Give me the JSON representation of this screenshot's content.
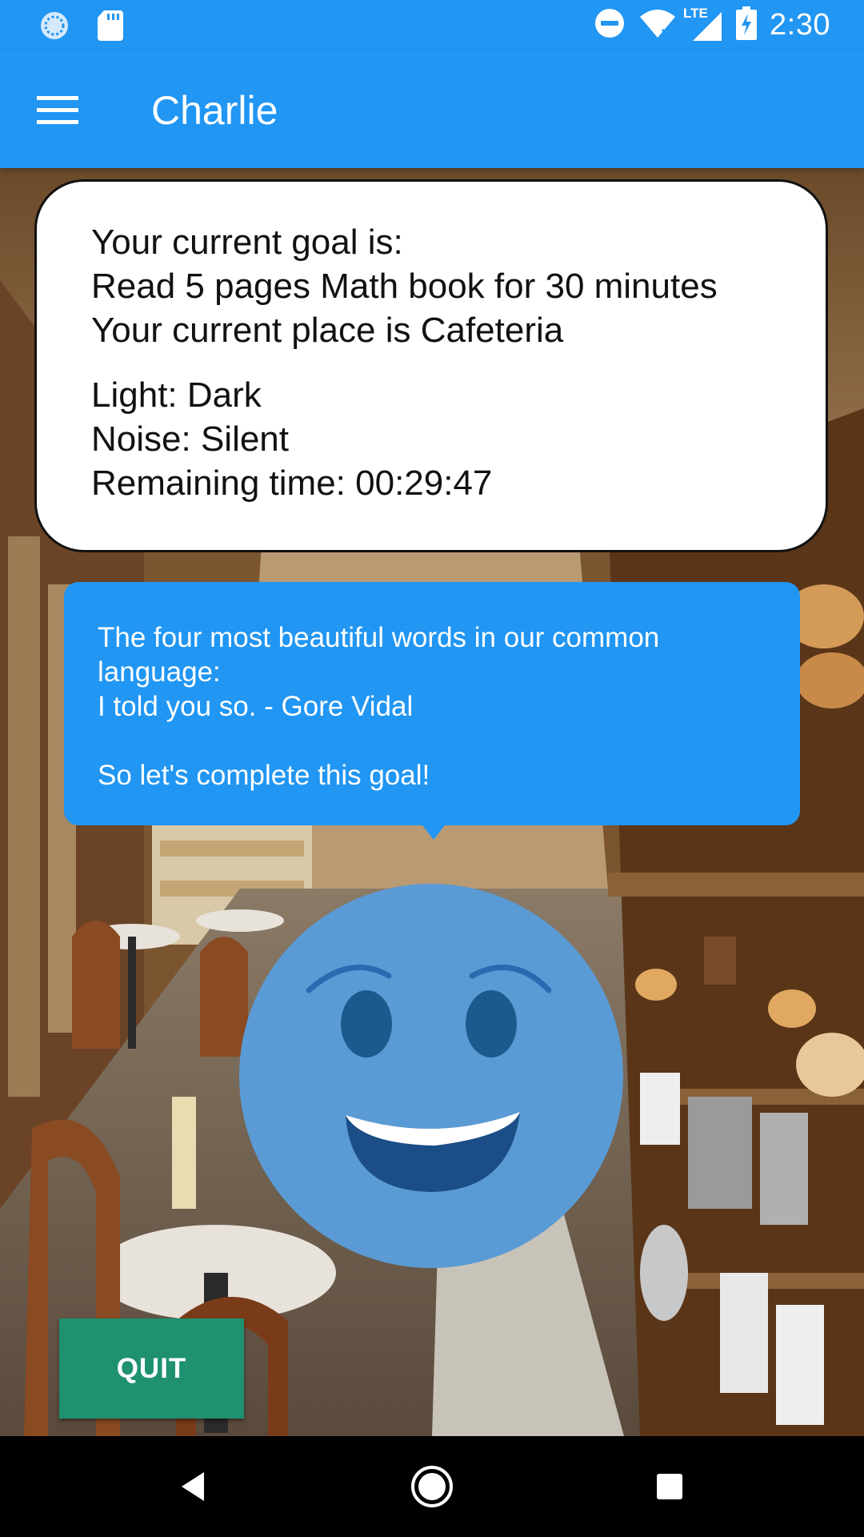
{
  "status_bar": {
    "time": "2:30",
    "network": "LTE",
    "icons": [
      "sync-icon",
      "sd-card-icon",
      "do-not-disturb-icon",
      "wifi-icon",
      "signal-icon",
      "battery-charging-icon"
    ]
  },
  "app_bar": {
    "title": "Charlie",
    "menu_icon": "hamburger-menu-icon"
  },
  "goal_card": {
    "goal_heading": "Your current goal is:",
    "goal_text": "Read 5 pages Math book for 30 minutes",
    "place_text": "Your current place is Cafeteria",
    "light": "Light: Dark",
    "noise": "Noise: Silent",
    "remaining": "Remaining time: 00:29:47"
  },
  "quote_bubble": {
    "line1": "The four most beautiful words in our common",
    "line2": "language:",
    "line3": "I told you so. - Gore Vidal",
    "cta": "So let's complete this goal!"
  },
  "mascot": {
    "icon": "smiley-face-icon",
    "color": "#5a9bd5"
  },
  "quit_button": {
    "label": "QUIT",
    "color": "#1f9170"
  },
  "nav_bar": {
    "icons": [
      "back-icon",
      "home-icon",
      "recents-icon"
    ]
  },
  "colors": {
    "primary": "#2196F3",
    "card_border": "#111111"
  }
}
